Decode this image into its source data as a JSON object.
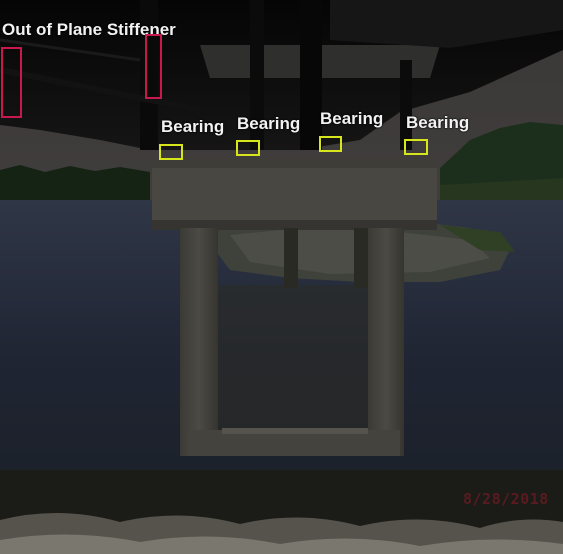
{
  "annotations": {
    "stiffener_label": "Out of Plane Stiffener",
    "bearing_labels": [
      "Bearing",
      "Bearing",
      "Bearing",
      "Bearing"
    ]
  },
  "photo": {
    "date_stamp": "8/28/2018"
  },
  "colors": {
    "stiffener_box": "#c8184e",
    "bearing_box": "#d7e61a"
  }
}
